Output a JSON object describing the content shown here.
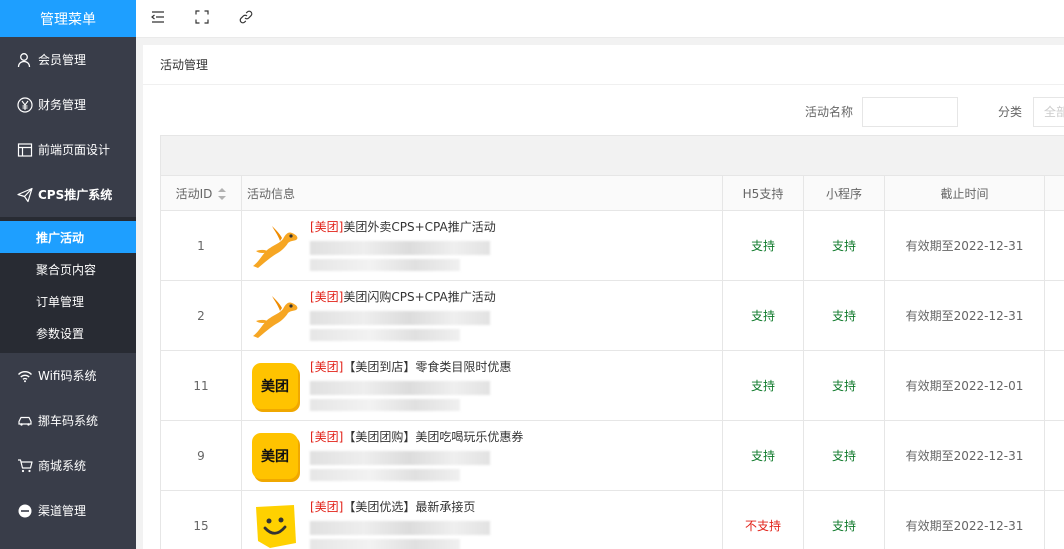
{
  "sidebar": {
    "title": "管理菜单",
    "items": [
      {
        "label": "会员管理",
        "icon": "user-icon"
      },
      {
        "label": "财务管理",
        "icon": "yen-icon"
      },
      {
        "label": "前端页面设计",
        "icon": "layout-icon"
      },
      {
        "label": "CPS推广系统",
        "icon": "send-icon"
      },
      {
        "label": "Wifi码系统",
        "icon": "wifi-icon"
      },
      {
        "label": "挪车码系统",
        "icon": "car-icon"
      },
      {
        "label": "商城系统",
        "icon": "cart-icon"
      },
      {
        "label": "渠道管理",
        "icon": "channel-icon"
      }
    ],
    "sub_items": [
      {
        "label": "推广活动"
      },
      {
        "label": "聚合页内容"
      },
      {
        "label": "订单管理"
      },
      {
        "label": "参数设置"
      }
    ]
  },
  "topbar": {
    "icons": [
      "menu-toggle-icon",
      "fullscreen-icon",
      "link-icon"
    ]
  },
  "card": {
    "title": "活动管理"
  },
  "filters": {
    "name_label": "活动名称",
    "name_value": "",
    "category_label": "分类",
    "category_value": "全部"
  },
  "table": {
    "headers": [
      "活动ID",
      "活动信息",
      "H5支持",
      "小程序",
      "截止时间"
    ],
    "rows": [
      {
        "id": "1",
        "tag": "[美团]",
        "title": "美团外卖CPS+CPA推广活动",
        "thumb": "kangaroo",
        "h5": "支持",
        "h5_ok": true,
        "mini": "支持",
        "deadline": "有效期至2022-12-31"
      },
      {
        "id": "2",
        "tag": "[美团]",
        "title": "美团闪购CPS+CPA推广活动",
        "thumb": "kangaroo",
        "h5": "支持",
        "h5_ok": true,
        "mini": "支持",
        "deadline": "有效期至2022-12-31"
      },
      {
        "id": "11",
        "tag": "[美团]",
        "title": "【美团到店】零食类目限时优惠",
        "thumb": "meituan",
        "h5": "支持",
        "h5_ok": true,
        "mini": "支持",
        "deadline": "有效期至2022-12-01"
      },
      {
        "id": "9",
        "tag": "[美团]",
        "title": "【美团团购】美团吃喝玩乐优惠券",
        "thumb": "meituan",
        "h5": "支持",
        "h5_ok": true,
        "mini": "支持",
        "deadline": "有效期至2022-12-31"
      },
      {
        "id": "15",
        "tag": "[美团]",
        "title": "【美团优选】最新承接页",
        "thumb": "smile",
        "h5": "不支持",
        "h5_ok": false,
        "mini": "支持",
        "deadline": "有效期至2022-12-31"
      }
    ],
    "meituan_logo_text": "美团"
  },
  "colors": {
    "accent": "#1e9fff",
    "sidebar": "#393d49",
    "yes": "#0f7a2b",
    "no": "#e2231a"
  }
}
